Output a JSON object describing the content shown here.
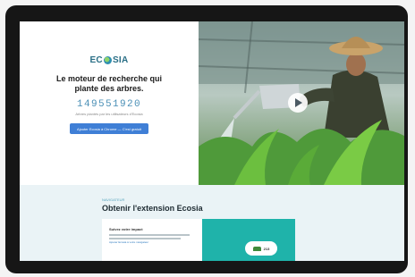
{
  "brand": {
    "logo_text_left": "EC",
    "logo_text_right": "SIA"
  },
  "hero": {
    "tagline": "Le moteur de recherche qui plante des arbres.",
    "counter": "149551920",
    "counter_caption": "Arbres plantés par les utilisateurs d'Ecosia",
    "cta_label": "Ajouter Ecosia à Chrome — C'est gratuit"
  },
  "extension": {
    "kicker": "NAVIGATEUR",
    "heading": "Obtenir l'extension Ecosia",
    "card_title": "Suivez votre impact",
    "card_link": "Ajouter Ecosia à votre navigateur",
    "pill_count": "213"
  },
  "colors": {
    "accent_blue": "#3f7fd6",
    "teal": "#1fb3aa",
    "counter_blue": "#4a8fb6"
  }
}
